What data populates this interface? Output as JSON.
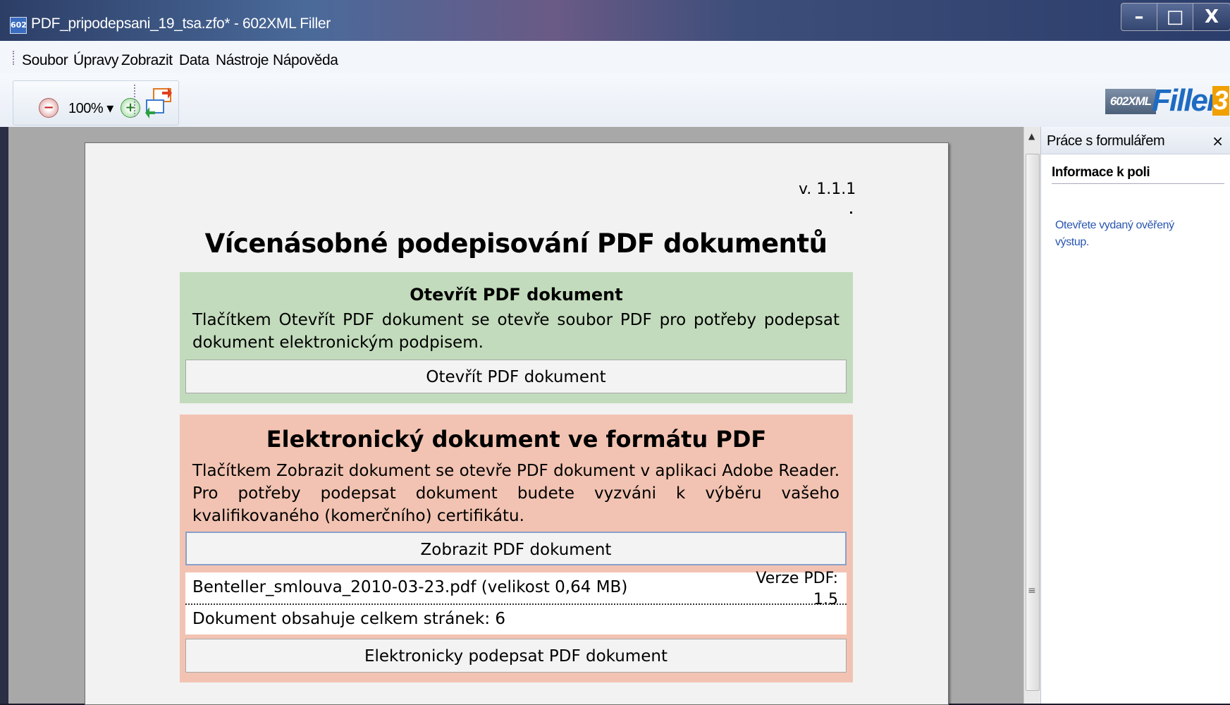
{
  "window": {
    "title": "PDF_pripodepsani_19_tsa.zfo* - 602XML Filler",
    "app_icon": "602",
    "controls": {
      "minimize": "–",
      "maximize": "□",
      "close": "X"
    }
  },
  "menu": [
    "Soubor",
    "Úpravy",
    "Zobrazit",
    "Data",
    "Nástroje",
    "Nápověda"
  ],
  "toolbar": {
    "zoom_out_icon": "zoom-out-icon",
    "zoom_level": "100% ▾",
    "zoom_in_icon": "zoom-in-icon",
    "swap_icon": "form-swap-icon"
  },
  "brand": {
    "prefix": "602XML",
    "name": "Filler",
    "version": "3"
  },
  "document": {
    "version": "v. 1.1.1",
    "title": "Vícenásobné podepisování PDF dokumentů",
    "open_section": {
      "heading": "Otevřít PDF dokument",
      "text": "Tlačítkem Otevřít PDF dokument se otevře soubor PDF pro potřeby podepsat dokument elektronickým podpisem.",
      "button": "Otevřít PDF dokument",
      "color": "#c2dbbc"
    },
    "pdf_section": {
      "heading": "Elektronický dokument ve formátu PDF",
      "text": "Tlačítkem Zobrazit dokument se otevře PDF dokument v aplikaci Adobe Reader. Pro potřeby podepsat dokument budete vyzváni k výběru vašeho kvalifikovaného (komerčního) certifikátu.",
      "show_button": "Zobrazit PDF dokument",
      "file_info": "Benteller_smlouva_2010-03-23.pdf (velikost 0,64 MB)",
      "pdf_version_label": "Verze PDF:",
      "pdf_version_value": "1.5",
      "pages_info": "Dokument obsahuje celkem stránek: 6",
      "sign_button": "Elektronicky podepsat PDF dokument",
      "color": "#f2c3b2"
    }
  },
  "side_panel": {
    "title": "Práce s formulářem",
    "close": "×",
    "section": "Informace k poli",
    "message": "Otevřete vydaný ověřený výstup."
  }
}
